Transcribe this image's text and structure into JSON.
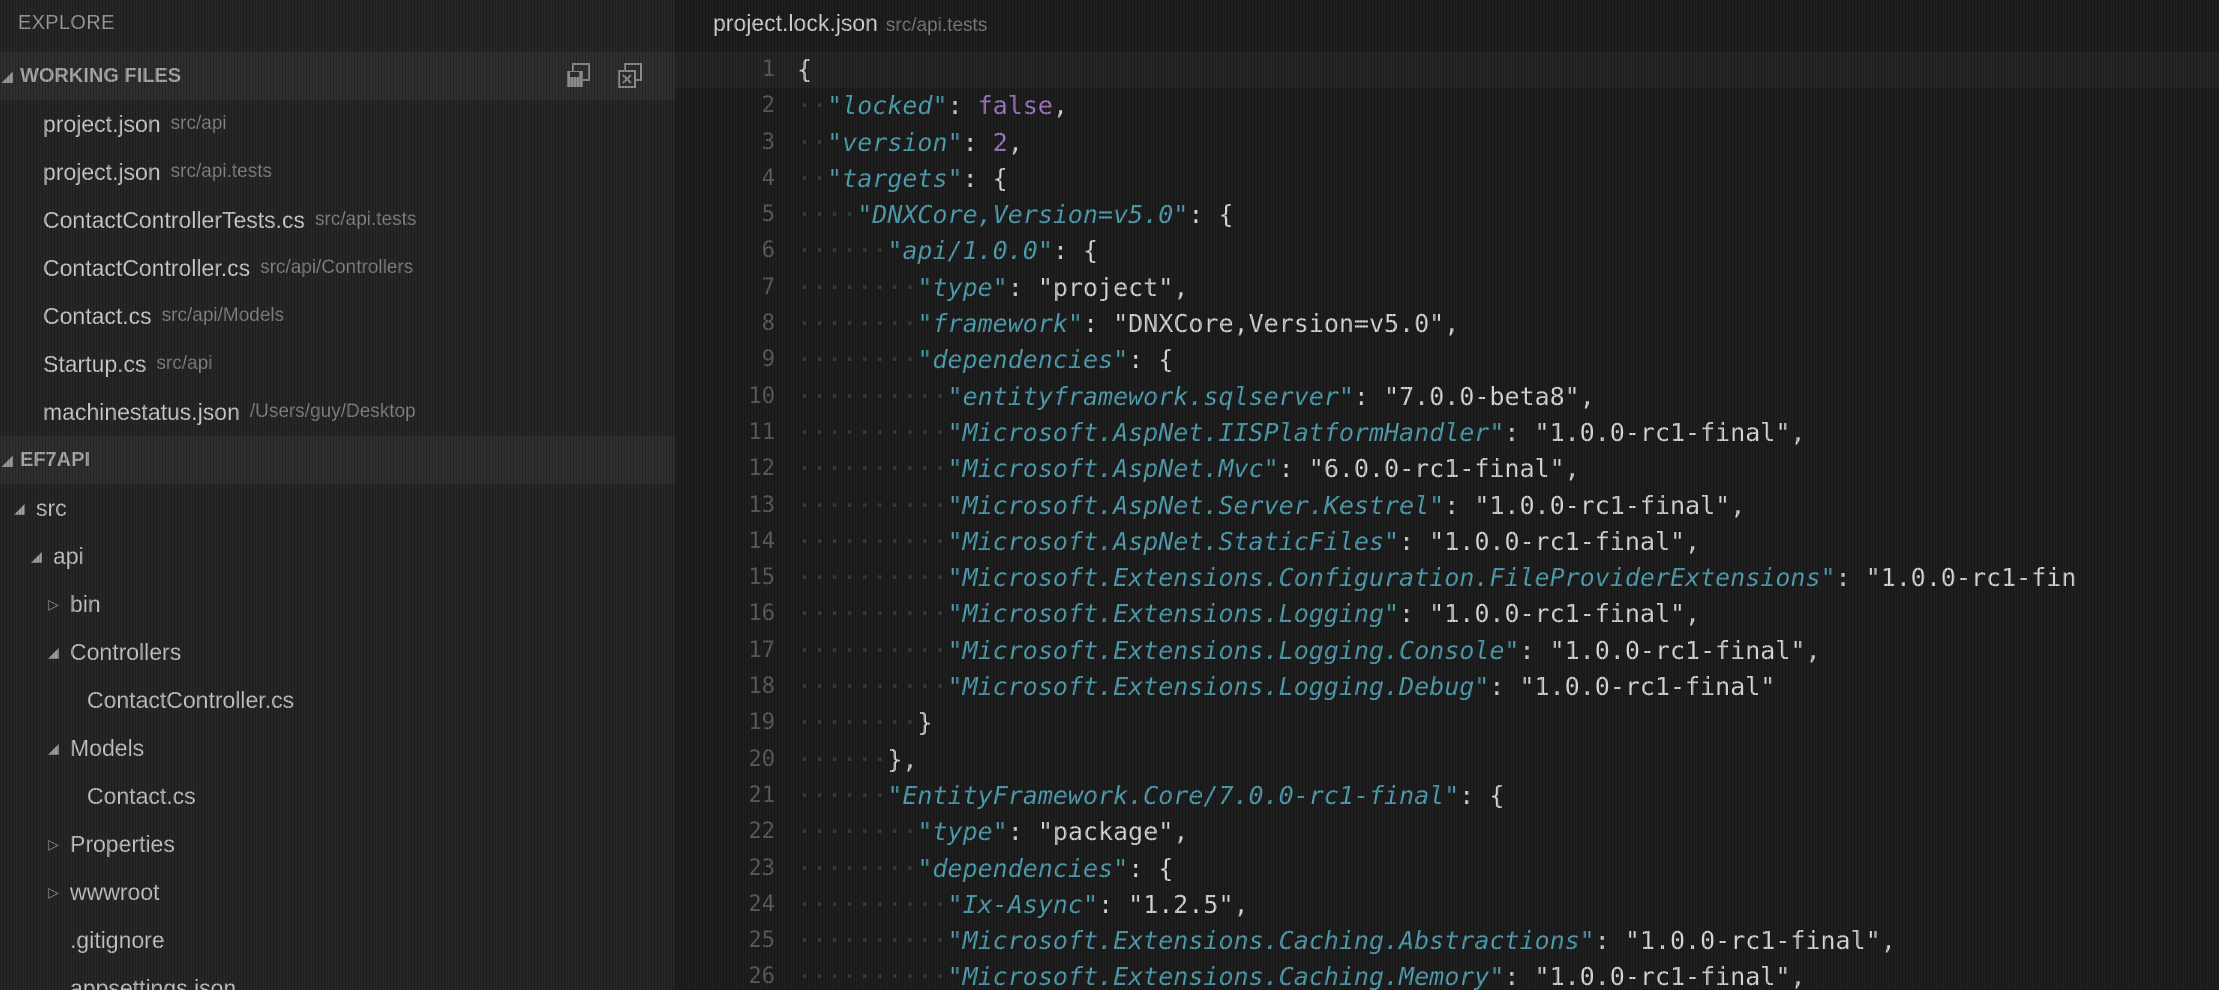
{
  "sidebar": {
    "title": "EXPLORE",
    "working_files": {
      "header": "WORKING FILES",
      "items": [
        {
          "name": "project.json",
          "path": "src/api"
        },
        {
          "name": "project.json",
          "path": "src/api.tests"
        },
        {
          "name": "ContactControllerTests.cs",
          "path": "src/api.tests"
        },
        {
          "name": "ContactController.cs",
          "path": "src/api/Controllers"
        },
        {
          "name": "Contact.cs",
          "path": "src/api/Models"
        },
        {
          "name": "Startup.cs",
          "path": "src/api"
        },
        {
          "name": "machinestatus.json",
          "path": "/Users/guy/Desktop"
        }
      ]
    },
    "project": {
      "header": "EF7API",
      "tree": [
        {
          "label": "src",
          "depth": 0,
          "twisty": "open"
        },
        {
          "label": "api",
          "depth": 1,
          "twisty": "open"
        },
        {
          "label": "bin",
          "depth": 2,
          "twisty": "closed"
        },
        {
          "label": "Controllers",
          "depth": 2,
          "twisty": "open"
        },
        {
          "label": "ContactController.cs",
          "depth": 3,
          "twisty": "none"
        },
        {
          "label": "Models",
          "depth": 2,
          "twisty": "open"
        },
        {
          "label": "Contact.cs",
          "depth": 3,
          "twisty": "none"
        },
        {
          "label": "Properties",
          "depth": 2,
          "twisty": "closed"
        },
        {
          "label": "wwwroot",
          "depth": 2,
          "twisty": "closed"
        },
        {
          "label": ".gitignore",
          "depth": 2,
          "twisty": "none"
        },
        {
          "label": "appsettings.json",
          "depth": 2,
          "twisty": "none"
        }
      ]
    }
  },
  "editor": {
    "file_name": "project.lock.json",
    "file_path": "src/api.tests",
    "current_line": 1,
    "lines": [
      {
        "num": "1",
        "indent": 0,
        "tokens": [
          {
            "t": "p",
            "v": "{"
          }
        ]
      },
      {
        "num": "2",
        "indent": 1,
        "tokens": [
          {
            "t": "k",
            "v": "\"locked\""
          },
          {
            "t": "p",
            "v": ": "
          },
          {
            "t": "n",
            "v": "false"
          },
          {
            "t": "p",
            "v": ","
          }
        ]
      },
      {
        "num": "3",
        "indent": 1,
        "tokens": [
          {
            "t": "k",
            "v": "\"version\""
          },
          {
            "t": "p",
            "v": ": "
          },
          {
            "t": "n",
            "v": "2"
          },
          {
            "t": "p",
            "v": ","
          }
        ]
      },
      {
        "num": "4",
        "indent": 1,
        "tokens": [
          {
            "t": "k",
            "v": "\"targets\""
          },
          {
            "t": "p",
            "v": ": {"
          }
        ]
      },
      {
        "num": "5",
        "indent": 2,
        "tokens": [
          {
            "t": "k",
            "v": "\"DNXCore,Version=v5.0\""
          },
          {
            "t": "p",
            "v": ": {"
          }
        ]
      },
      {
        "num": "6",
        "indent": 3,
        "tokens": [
          {
            "t": "k",
            "v": "\"api/1.0.0\""
          },
          {
            "t": "p",
            "v": ": {"
          }
        ]
      },
      {
        "num": "7",
        "indent": 4,
        "tokens": [
          {
            "t": "k",
            "v": "\"type\""
          },
          {
            "t": "p",
            "v": ": "
          },
          {
            "t": "s",
            "v": "\"project\""
          },
          {
            "t": "p",
            "v": ","
          }
        ]
      },
      {
        "num": "8",
        "indent": 4,
        "tokens": [
          {
            "t": "k",
            "v": "\"framework\""
          },
          {
            "t": "p",
            "v": ": "
          },
          {
            "t": "s",
            "v": "\"DNXCore,Version=v5.0\""
          },
          {
            "t": "p",
            "v": ","
          }
        ]
      },
      {
        "num": "9",
        "indent": 4,
        "tokens": [
          {
            "t": "k",
            "v": "\"dependencies\""
          },
          {
            "t": "p",
            "v": ": {"
          }
        ]
      },
      {
        "num": "10",
        "indent": 5,
        "tokens": [
          {
            "t": "k",
            "v": "\"entityframework.sqlserver\""
          },
          {
            "t": "p",
            "v": ": "
          },
          {
            "t": "s",
            "v": "\"7.0.0-beta8\""
          },
          {
            "t": "p",
            "v": ","
          }
        ]
      },
      {
        "num": "11",
        "indent": 5,
        "tokens": [
          {
            "t": "k",
            "v": "\"Microsoft.AspNet.IISPlatformHandler\""
          },
          {
            "t": "p",
            "v": ": "
          },
          {
            "t": "s",
            "v": "\"1.0.0-rc1-final\""
          },
          {
            "t": "p",
            "v": ","
          }
        ]
      },
      {
        "num": "12",
        "indent": 5,
        "tokens": [
          {
            "t": "k",
            "v": "\"Microsoft.AspNet.Mvc\""
          },
          {
            "t": "p",
            "v": ": "
          },
          {
            "t": "s",
            "v": "\"6.0.0-rc1-final\""
          },
          {
            "t": "p",
            "v": ","
          }
        ]
      },
      {
        "num": "13",
        "indent": 5,
        "tokens": [
          {
            "t": "k",
            "v": "\"Microsoft.AspNet.Server.Kestrel\""
          },
          {
            "t": "p",
            "v": ": "
          },
          {
            "t": "s",
            "v": "\"1.0.0-rc1-final\""
          },
          {
            "t": "p",
            "v": ","
          }
        ]
      },
      {
        "num": "14",
        "indent": 5,
        "tokens": [
          {
            "t": "k",
            "v": "\"Microsoft.AspNet.StaticFiles\""
          },
          {
            "t": "p",
            "v": ": "
          },
          {
            "t": "s",
            "v": "\"1.0.0-rc1-final\""
          },
          {
            "t": "p",
            "v": ","
          }
        ]
      },
      {
        "num": "15",
        "indent": 5,
        "tokens": [
          {
            "t": "k",
            "v": "\"Microsoft.Extensions.Configuration.FileProviderExtensions\""
          },
          {
            "t": "p",
            "v": ": "
          },
          {
            "t": "s",
            "v": "\"1.0.0-rc1-fin"
          }
        ]
      },
      {
        "num": "16",
        "indent": 5,
        "tokens": [
          {
            "t": "k",
            "v": "\"Microsoft.Extensions.Logging\""
          },
          {
            "t": "p",
            "v": ": "
          },
          {
            "t": "s",
            "v": "\"1.0.0-rc1-final\""
          },
          {
            "t": "p",
            "v": ","
          }
        ]
      },
      {
        "num": "17",
        "indent": 5,
        "tokens": [
          {
            "t": "k",
            "v": "\"Microsoft.Extensions.Logging.Console\""
          },
          {
            "t": "p",
            "v": ": "
          },
          {
            "t": "s",
            "v": "\"1.0.0-rc1-final\""
          },
          {
            "t": "p",
            "v": ","
          }
        ]
      },
      {
        "num": "18",
        "indent": 5,
        "tokens": [
          {
            "t": "k",
            "v": "\"Microsoft.Extensions.Logging.Debug\""
          },
          {
            "t": "p",
            "v": ": "
          },
          {
            "t": "s",
            "v": "\"1.0.0-rc1-final\""
          }
        ]
      },
      {
        "num": "19",
        "indent": 4,
        "tokens": [
          {
            "t": "p",
            "v": "}"
          }
        ]
      },
      {
        "num": "20",
        "indent": 3,
        "tokens": [
          {
            "t": "p",
            "v": "},"
          }
        ]
      },
      {
        "num": "21",
        "indent": 3,
        "tokens": [
          {
            "t": "k",
            "v": "\"EntityFramework.Core/7.0.0-rc1-final\""
          },
          {
            "t": "p",
            "v": ": {"
          }
        ]
      },
      {
        "num": "22",
        "indent": 4,
        "tokens": [
          {
            "t": "k",
            "v": "\"type\""
          },
          {
            "t": "p",
            "v": ": "
          },
          {
            "t": "s",
            "v": "\"package\""
          },
          {
            "t": "p",
            "v": ","
          }
        ]
      },
      {
        "num": "23",
        "indent": 4,
        "tokens": [
          {
            "t": "k",
            "v": "\"dependencies\""
          },
          {
            "t": "p",
            "v": ": {"
          }
        ]
      },
      {
        "num": "24",
        "indent": 5,
        "tokens": [
          {
            "t": "k",
            "v": "\"Ix-Async\""
          },
          {
            "t": "p",
            "v": ": "
          },
          {
            "t": "s",
            "v": "\"1.2.5\""
          },
          {
            "t": "p",
            "v": ","
          }
        ]
      },
      {
        "num": "25",
        "indent": 5,
        "tokens": [
          {
            "t": "k",
            "v": "\"Microsoft.Extensions.Caching.Abstractions\""
          },
          {
            "t": "p",
            "v": ": "
          },
          {
            "t": "s",
            "v": "\"1.0.0-rc1-final\""
          },
          {
            "t": "p",
            "v": ","
          }
        ]
      },
      {
        "num": "26",
        "indent": 5,
        "tokens": [
          {
            "t": "k",
            "v": "\"Microsoft.Extensions.Caching.Memory\""
          },
          {
            "t": "p",
            "v": ": "
          },
          {
            "t": "s",
            "v": "\"1.0.0-rc1-final\""
          },
          {
            "t": "p",
            "v": ","
          }
        ]
      }
    ]
  },
  "colors": {
    "key": "#4f9fb0",
    "literal": "#a178c6",
    "text": "#d4d4d4",
    "sidebar_bg": "#262626",
    "editor_bg": "#1e1e1e"
  },
  "icons": {
    "save_all": "save-all-icon",
    "close_all": "close-all-icon",
    "twisty_open": "chevron-down-icon",
    "twisty_closed": "chevron-right-icon"
  }
}
